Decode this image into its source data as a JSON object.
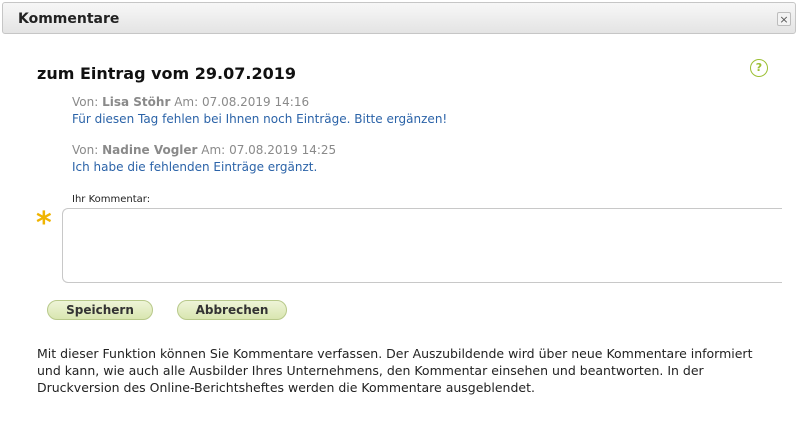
{
  "dialog": {
    "title": "Kommentare",
    "close_symbol": "×"
  },
  "help": {
    "icon": "help-question-icon",
    "symbol": "?"
  },
  "heading": "zum Eintrag vom 29.07.2019",
  "comments": [
    {
      "von_label": "Von:",
      "author": "Lisa Stöhr",
      "am_label": "Am:",
      "datetime": "07.08.2019 14:16",
      "text": "Für diesen Tag fehlen bei Ihnen noch Einträge. Bitte ergänzen!"
    },
    {
      "von_label": "Von:",
      "author": "Nadine Vogler",
      "am_label": "Am:",
      "datetime": "07.08.2019 14:25",
      "text": "Ich habe die fehlenden Einträge ergänzt."
    }
  ],
  "form": {
    "label": "Ihr Kommentar:",
    "required_marker": "*",
    "value": "",
    "save_label": "Speichern",
    "cancel_label": "Abbrechen"
  },
  "info_text": "Mit dieser Funktion können Sie Kommentare verfassen. Der Auszubildende wird über neue Kommentare informiert und kann, wie auch alle Ausbilder Ihres Unternehmens, den Kommentar einsehen und beantworten. In der Druckversion des Online-Berichtsheftes werden die Kommentare ausgeblendet.",
  "colors": {
    "accent_green": "#9bbf32",
    "comment_blue": "#2b63a8",
    "required_yellow": "#f0b400"
  }
}
